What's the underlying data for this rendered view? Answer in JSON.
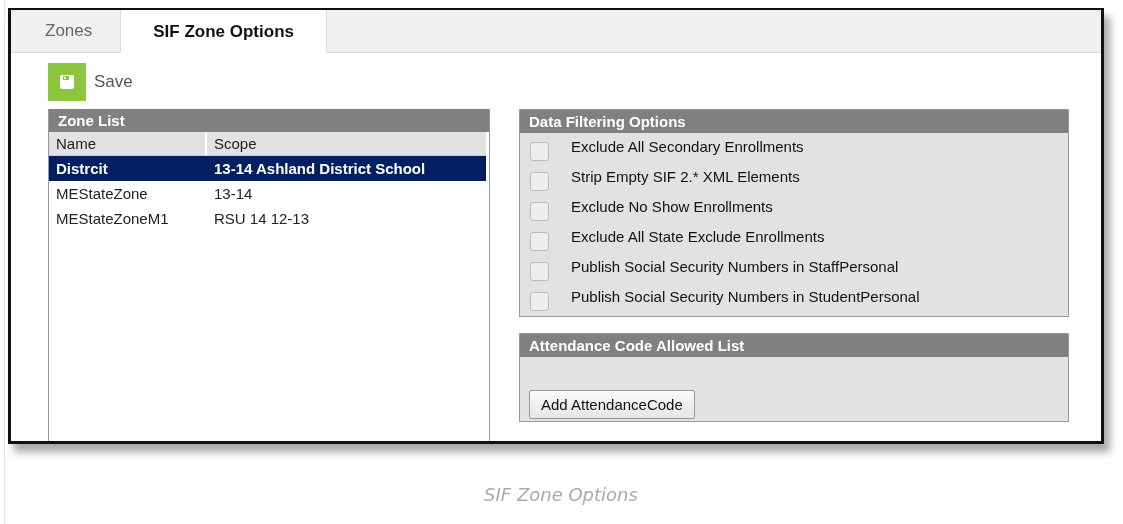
{
  "tabs": [
    {
      "label": "Zones",
      "selected": false
    },
    {
      "label": "SIF Zone Options",
      "selected": true
    }
  ],
  "toolbar": {
    "save_label": "Save"
  },
  "zone_list": {
    "title": "Zone List",
    "columns": [
      "Name",
      "Scope"
    ],
    "rows": [
      {
        "name": "Distrcit",
        "scope": "13-14 Ashland District School",
        "selected": true
      },
      {
        "name": "MEStateZone",
        "scope": "13-14",
        "selected": false
      },
      {
        "name": "MEStateZoneM1",
        "scope": "RSU 14 12-13",
        "selected": false
      }
    ]
  },
  "data_filtering": {
    "title": "Data Filtering Options",
    "options": [
      {
        "label": "Exclude All Secondary Enrollments",
        "checked": false
      },
      {
        "label": "Strip Empty SIF 2.* XML Elements",
        "checked": false
      },
      {
        "label": "Exclude No Show Enrollments",
        "checked": false
      },
      {
        "label": "Exclude All State Exclude Enrollments",
        "checked": false
      },
      {
        "label": "Publish Social Security Numbers in StaffPersonal",
        "checked": false
      },
      {
        "label": "Publish Social Security Numbers in StudentPersonal",
        "checked": false
      }
    ]
  },
  "attendance": {
    "title": "Attendance Code Allowed List",
    "button": "Add AttendanceCode"
  },
  "caption": "SIF Zone Options"
}
